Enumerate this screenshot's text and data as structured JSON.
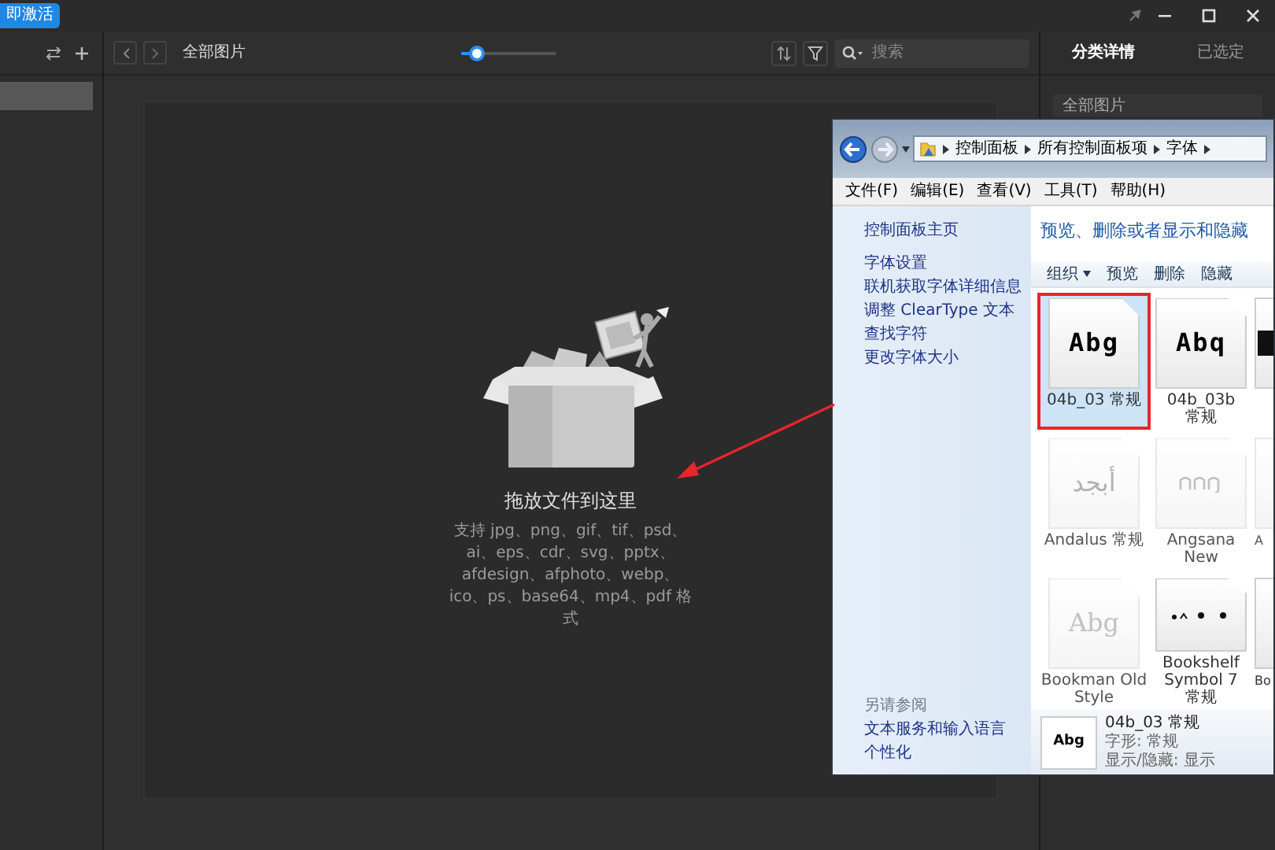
{
  "title_bar": {
    "badge": "即激活"
  },
  "sidebar": {
    "items": [
      {
        "selected": true
      }
    ]
  },
  "toolbar": {
    "title": "全部图片",
    "zoom_slider": {
      "level": 0.17
    },
    "search": {
      "placeholder": "搜索"
    }
  },
  "drop_zone": {
    "title": "拖放文件到这里",
    "formats": "支持 jpg、png、gif、tif、psd、ai、eps、cdr、svg、pptx、afdesign、afphoto、webp、ico、ps、base64、mp4、pdf 格式"
  },
  "inspector": {
    "tabs": [
      {
        "label": "分类详情",
        "selected": true
      },
      {
        "label": "已选定",
        "selected": false
      }
    ],
    "folder_name": "全部图片"
  },
  "explorer": {
    "breadcrumb": [
      "控制面板",
      "所有控制面板项",
      "字体"
    ],
    "menu": [
      "文件(F)",
      "编辑(E)",
      "查看(V)",
      "工具(T)",
      "帮助(H)"
    ],
    "tasks": [
      "控制面板主页",
      "字体设置",
      "联机获取字体详细信息",
      "调整 ClearType 文本",
      "查找字符",
      "更改字体大小"
    ],
    "see_also_title": "另请参阅",
    "see_also": [
      "文本服务和输入语言",
      "个性化"
    ],
    "heading": "预览、删除或者显示和隐藏",
    "commands": [
      {
        "label": "组织",
        "dropdown": true
      },
      {
        "label": "预览",
        "dropdown": false
      },
      {
        "label": "删除",
        "dropdown": false
      },
      {
        "label": "隐藏",
        "dropdown": false
      }
    ],
    "fonts": [
      {
        "label": "04b_03 常规",
        "kind": "pixel",
        "sample": "Abg",
        "faded": false,
        "selected": true
      },
      {
        "label": "04b_03b 常规",
        "kind": "pixel",
        "sample": "Abq",
        "faded": false,
        "selected": false
      },
      {
        "kind": "block",
        "faded": false,
        "selected": false
      },
      {
        "label": "Andalus 常规",
        "kind": "arabic",
        "sample": "أبجد",
        "faded": true,
        "selected": false
      },
      {
        "label": "Angsana New",
        "kind": "glyphs",
        "faded": true,
        "selected": false
      },
      {
        "label": "A",
        "kind": "blank",
        "faded": true,
        "selected": false
      },
      {
        "label": "Bookman Old Style",
        "kind": "serif",
        "sample": "Abg",
        "faded": true,
        "selected": false
      },
      {
        "label": "Bookshelf Symbol 7 常规",
        "kind": "dots",
        "faded": false,
        "selected": false
      },
      {
        "label": "Bo",
        "kind": "blank",
        "faded": false,
        "selected": false
      }
    ],
    "details": {
      "sample": "Abg",
      "name": "04b_03 常规",
      "properties": [
        "字形: 常规",
        "显示/隐藏: 显示"
      ]
    }
  }
}
